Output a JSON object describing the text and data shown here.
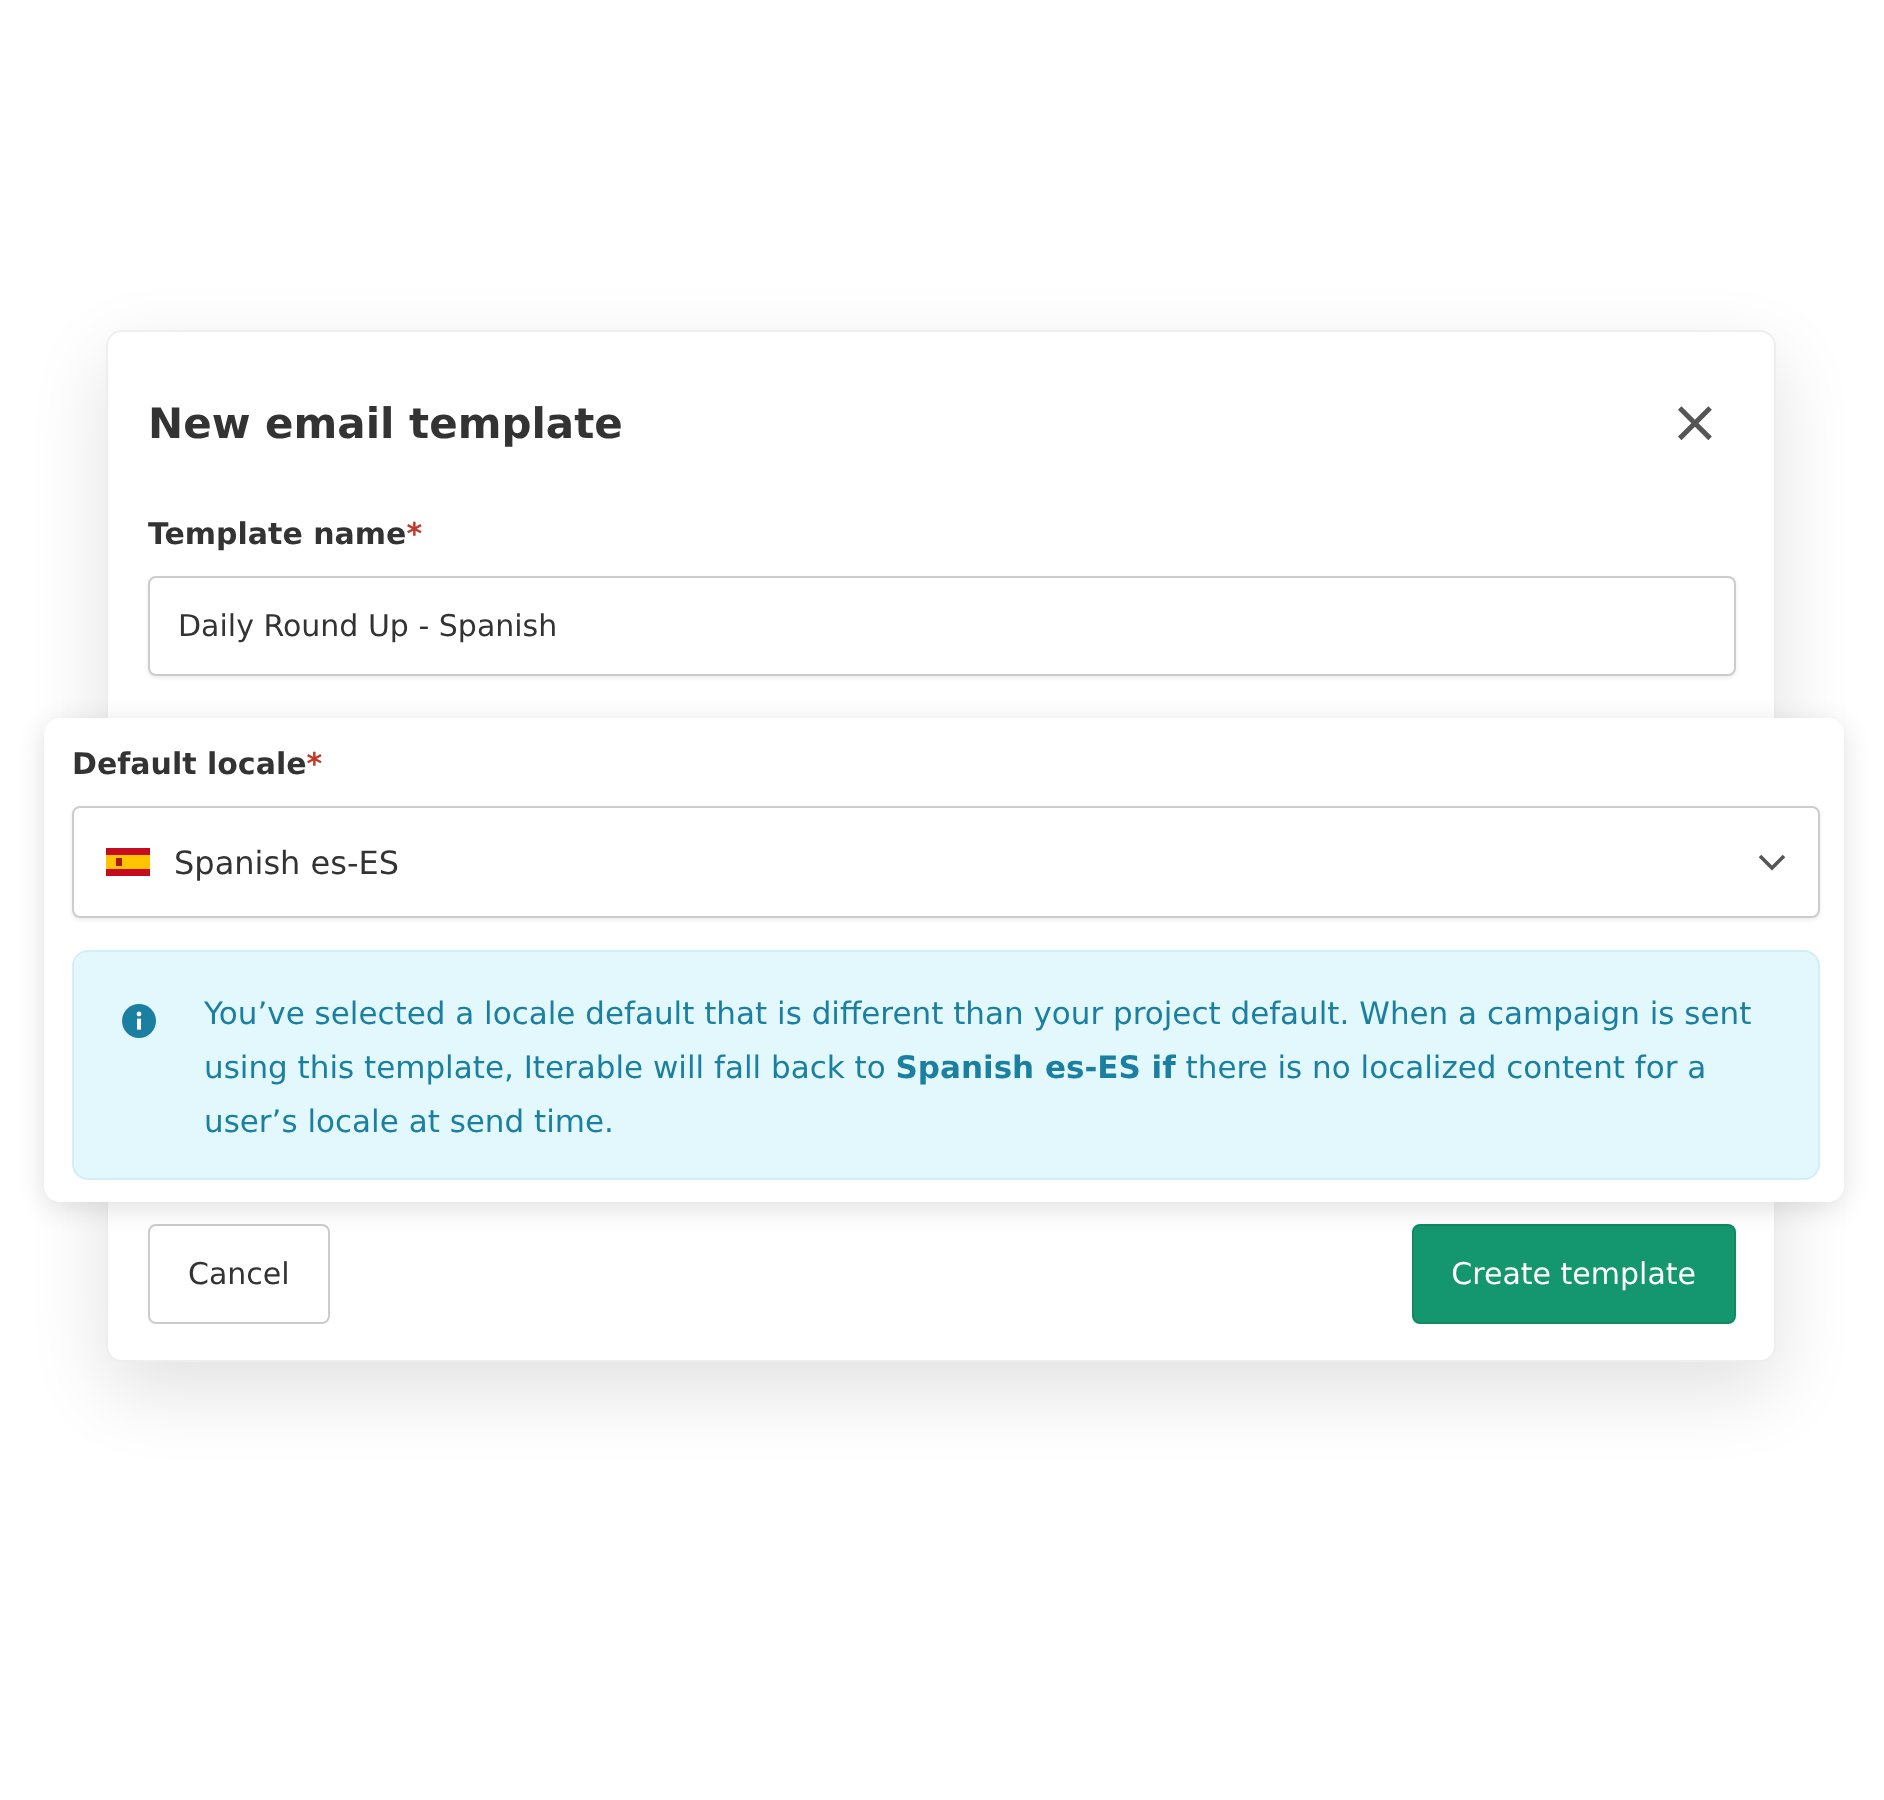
{
  "dialog": {
    "title": "New email template",
    "close": "×",
    "template_name": {
      "label": "Template name",
      "required_mark": "*",
      "value": "Daily Round Up - Spanish"
    },
    "buttons": [
      {
        "label": "Cancel",
        "kind": "secondary"
      },
      {
        "label": "Create template",
        "kind": "primary"
      }
    ]
  },
  "locale_popout": {
    "label": "Default locale",
    "required_mark": "*",
    "value": "Spanish es-ES",
    "notice": "You’ve selected a locale default that is different than your project default. When a campaign is sent using this template, Iterable will fall back to **Spanish es-ES if** there is no localized content for a user’s locale at send time."
  }
}
